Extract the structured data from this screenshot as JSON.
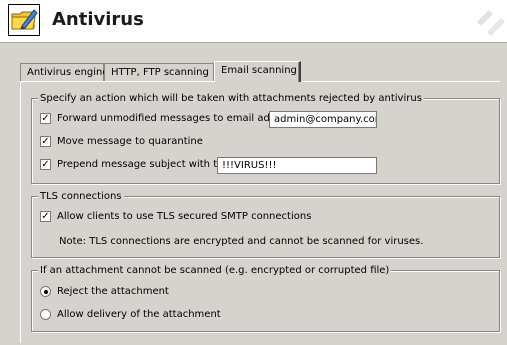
{
  "app": {
    "title": "Antivirus"
  },
  "tabs": [
    {
      "label": "Antivirus engine"
    },
    {
      "label": "HTTP, FTP scanning"
    },
    {
      "label": "Email scanning"
    }
  ],
  "rejected_attachments": {
    "legend": "Specify an action which will be taken with attachments rejected by antivirus",
    "forward": {
      "label": "Forward unmodified messages to email address:",
      "checked": true,
      "value": "admin@company.com"
    },
    "quarantine": {
      "label": "Move message to quarantine",
      "checked": true
    },
    "prepend": {
      "label": "Prepend message subject with text:",
      "checked": true,
      "value": "!!!VIRUS!!!"
    }
  },
  "tls": {
    "legend": "TLS connections",
    "allow": {
      "label": "Allow clients to use TLS secured SMTP connections",
      "checked": true
    },
    "note": "Note: TLS connections are encrypted and cannot be scanned for viruses."
  },
  "unscannable": {
    "legend": "If an attachment cannot be scanned (e.g. encrypted or corrupted file)",
    "reject": {
      "label": "Reject the attachment",
      "selected": true
    },
    "allow": {
      "label": "Allow delivery of the attachment",
      "selected": false
    }
  }
}
